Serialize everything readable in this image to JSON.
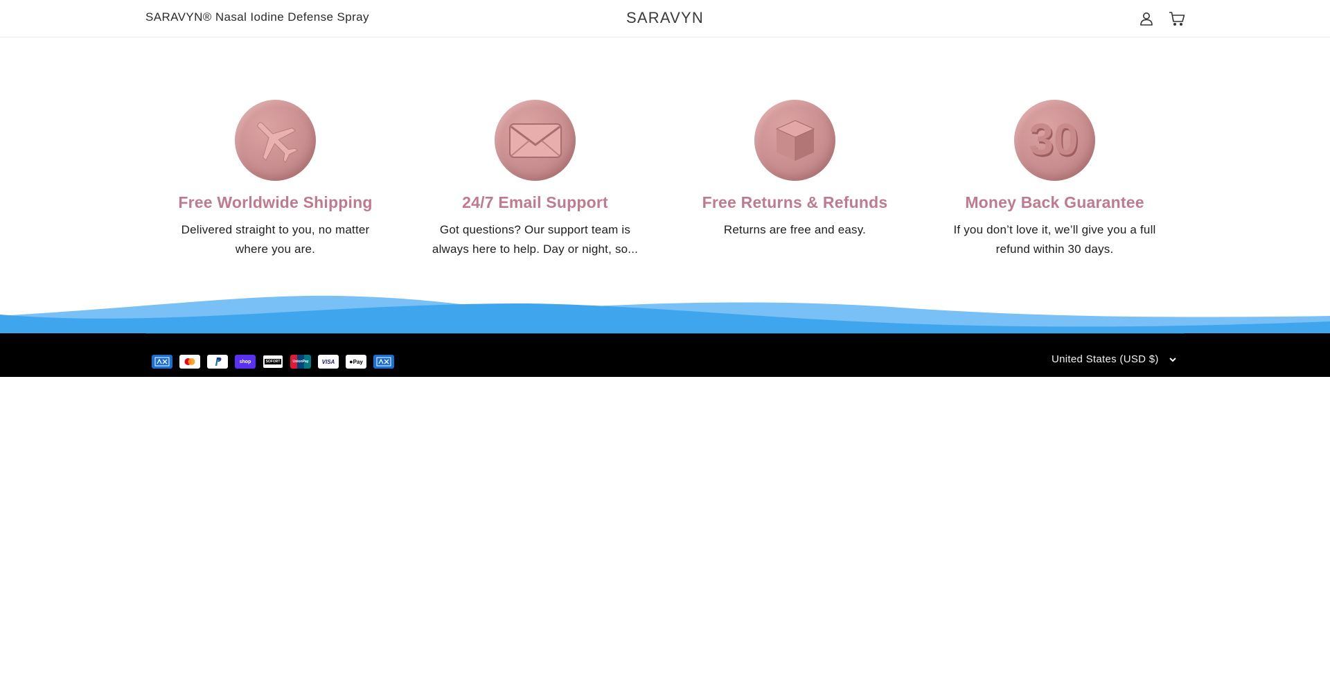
{
  "header": {
    "announcement": "SARAVYN® Nasal Iodine Defense Spray",
    "brand": "SARAVYN",
    "icons": [
      "account-icon",
      "cart-icon"
    ]
  },
  "features": [
    {
      "icon": "airplane-icon",
      "title": "Free Worldwide Shipping",
      "text": "Delivered straight to you, no matter where you are."
    },
    {
      "icon": "envelope-icon",
      "title": "24/7 Email Support",
      "text": "Got questions? Our support team is always here to help. Day or night, so..."
    },
    {
      "icon": "box-icon",
      "title": "Free Returns & Refunds",
      "text": "Returns are free and easy."
    },
    {
      "icon": "thirty-days-icon",
      "title": "Money Back Guarantee",
      "text": "If you don’t love it, we’ll give you a full refund within 30 days.",
      "badge": "30"
    }
  ],
  "footer": {
    "payment_methods": [
      "American Express",
      "Mastercard",
      "PayPal",
      "Shop Pay",
      "SOFORT",
      "UnionPay",
      "VISA",
      "Apple Pay",
      "American Express"
    ],
    "payment_labels": {
      "shop": "shop",
      "sofort": "SOFORT",
      "unionpay": "UnionPay",
      "visa": "VISA",
      "applepay": "Pay"
    },
    "currency": "United States (USD $)"
  },
  "colors": {
    "accent": "#bf7a8e",
    "icon_bg": "#c98f90",
    "wave_light": "#78c0f5",
    "wave_dark": "#3fa6ee",
    "footer_bg": "#000000"
  }
}
